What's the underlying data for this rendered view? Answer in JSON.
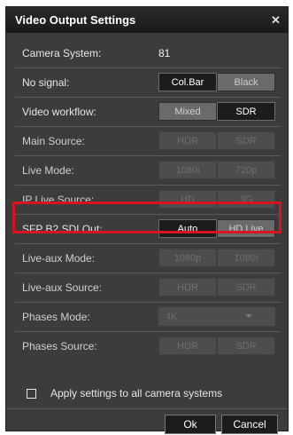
{
  "dialog": {
    "title": "Video Output Settings",
    "close_glyph": "✕"
  },
  "camera_system": {
    "label": "Camera System:",
    "value": "81"
  },
  "no_signal": {
    "label": "No signal:",
    "options": [
      "Col.Bar",
      "Black"
    ],
    "selected": "Col.Bar"
  },
  "video_workflow": {
    "label": "Video workflow:",
    "options": [
      "Mixed",
      "SDR"
    ],
    "selected": "SDR"
  },
  "main_source": {
    "label": "Main Source:",
    "options": [
      "HDR",
      "SDR"
    ],
    "enabled": false
  },
  "live_mode": {
    "label": "Live Mode:",
    "options": [
      "1080i",
      "720p"
    ],
    "enabled": false
  },
  "ip_live_source": {
    "label": "IP Live Source:",
    "options": [
      "HD",
      "3G"
    ],
    "enabled": false
  },
  "sfp_b2_sdi_out": {
    "label": "SFP B2 SDI Out:",
    "options": [
      "Auto",
      "HD Live"
    ],
    "selected": "Auto"
  },
  "live_aux_mode": {
    "label": "Live-aux Mode:",
    "options": [
      "1080p",
      "1080i"
    ],
    "enabled": false
  },
  "live_aux_source": {
    "label": "Live-aux Source:",
    "options": [
      "HDR",
      "SDR"
    ],
    "enabled": false
  },
  "phases_mode": {
    "label": "Phases Mode:",
    "value": "4K",
    "enabled": false
  },
  "phases_source": {
    "label": "Phases Source:",
    "options": [
      "HDR",
      "SDR"
    ],
    "enabled": false
  },
  "apply_all": {
    "label": "Apply settings to all camera systems",
    "checked": false
  },
  "buttons": {
    "ok": "Ok",
    "cancel": "Cancel"
  },
  "colors": {
    "dialog_bg": "#3c3c3c",
    "selected_bg": "#1c1c1c",
    "highlight": "#d9141e"
  }
}
